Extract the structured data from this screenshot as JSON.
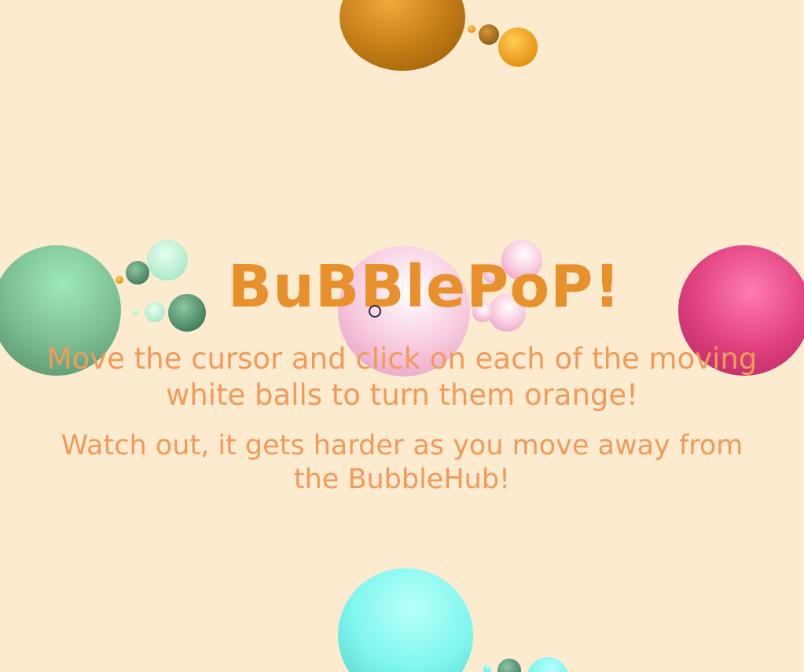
{
  "game": {
    "title": "BuBBlePoP!",
    "instruction_primary": "Move the cursor and click on each of the moving white balls to turn them orange!",
    "instruction_secondary": "Watch out, it gets harder as you move away from the BubbleHub!"
  },
  "colors": {
    "background": "#fdebd0",
    "title": "#e8902b",
    "text": "#f09b5c",
    "orange_bubble": "#d08a1a",
    "green_bubble": "#7fc79a",
    "pink_bubble": "#f5c2d8",
    "magenta_bubble": "#e0407e",
    "cyan_bubble": "#7ff7ee"
  }
}
